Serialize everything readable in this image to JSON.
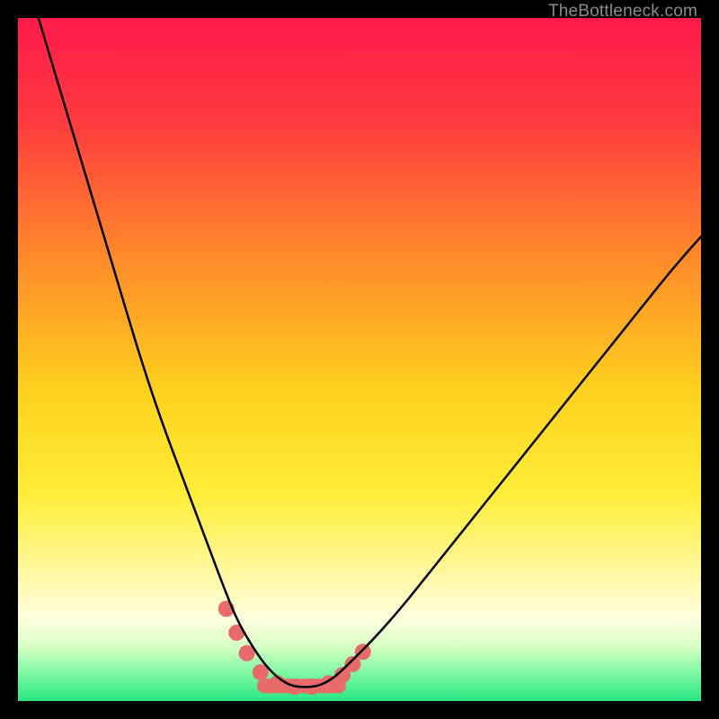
{
  "watermark": "TheBottleneck.com",
  "chart_data": {
    "type": "line",
    "title": "",
    "xlabel": "",
    "ylabel": "",
    "xlim": [
      0,
      100
    ],
    "ylim": [
      0,
      100
    ],
    "grid": false,
    "legend": false,
    "gradient_stops": [
      {
        "offset": 0.0,
        "color": "#ff1a4b"
      },
      {
        "offset": 0.15,
        "color": "#ff3a3f"
      },
      {
        "offset": 0.35,
        "color": "#ff8a2a"
      },
      {
        "offset": 0.55,
        "color": "#ffd21e"
      },
      {
        "offset": 0.7,
        "color": "#ffee3a"
      },
      {
        "offset": 0.82,
        "color": "#fff8a8"
      },
      {
        "offset": 0.88,
        "color": "#ffffe0"
      },
      {
        "offset": 0.92,
        "color": "#d6ffc2"
      },
      {
        "offset": 0.96,
        "color": "#7cf7a0"
      },
      {
        "offset": 1.0,
        "color": "#28e682"
      }
    ],
    "series": [
      {
        "name": "bottleneck-curve",
        "color": "#000000",
        "stroke_width": 2.5,
        "x": [
          3,
          6,
          9,
          12,
          15,
          18,
          21,
          24,
          27,
          28.5,
          30,
          32,
          34,
          36,
          38,
          40,
          42,
          44,
          46,
          48,
          52,
          56,
          60,
          64,
          68,
          72,
          76,
          80,
          84,
          88,
          92,
          96,
          100
        ],
        "y": [
          100,
          90,
          80,
          70,
          60,
          50,
          41,
          33,
          25,
          21,
          17,
          12,
          8.5,
          5.5,
          3.4,
          2.2,
          2.0,
          2.2,
          3.2,
          5.0,
          9.0,
          13.5,
          18.5,
          23.5,
          28.5,
          33.5,
          38.5,
          43.5,
          48.5,
          53.5,
          58.5,
          63.5,
          68.0
        ]
      }
    ],
    "markers": {
      "name": "bottom-dots",
      "color": "#e86a6a",
      "radius": 9,
      "points": [
        {
          "x": 30.5,
          "y": 13.5
        },
        {
          "x": 32.0,
          "y": 10.0
        },
        {
          "x": 33.5,
          "y": 7.0
        },
        {
          "x": 35.5,
          "y": 4.2
        },
        {
          "x": 38.0,
          "y": 2.6
        },
        {
          "x": 40.5,
          "y": 2.1
        },
        {
          "x": 43.0,
          "y": 2.1
        },
        {
          "x": 45.5,
          "y": 2.6
        },
        {
          "x": 47.5,
          "y": 3.8
        },
        {
          "x": 49.0,
          "y": 5.4
        },
        {
          "x": 50.5,
          "y": 7.2
        }
      ]
    },
    "bottom_bar": {
      "color": "#e86a6a",
      "x_start": 35.0,
      "x_end": 48.0,
      "y": 2.2,
      "thickness": 16
    }
  }
}
